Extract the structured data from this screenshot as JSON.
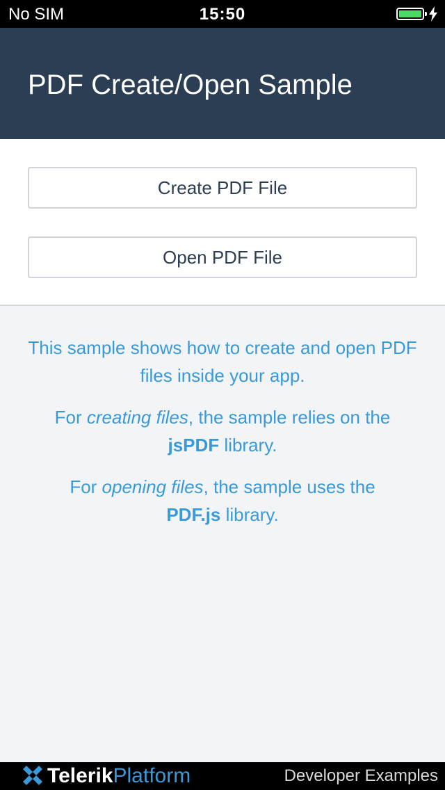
{
  "status_bar": {
    "carrier": "No SIM",
    "time": "15:50",
    "battery_level": 1.0,
    "battery_color": "#4cd964"
  },
  "header": {
    "title": "PDF Create/Open Sample",
    "background": "#2c3e53"
  },
  "actions": {
    "create_label": "Create PDF File",
    "open_label": "Open PDF File"
  },
  "info": {
    "intro": "This sample shows how to create and open PDF files inside your app.",
    "creating": {
      "prefix": "For ",
      "emphasis": "creating files",
      "middle": ", the sample relies on the ",
      "library": "jsPDF",
      "suffix": " library."
    },
    "opening": {
      "prefix": "For ",
      "emphasis": "opening files",
      "middle": ", the sample uses the ",
      "library": "PDF.js",
      "suffix": " library."
    },
    "text_color": "#3a9ad9"
  },
  "footer": {
    "brand_telerik": "Telerik",
    "brand_platform": "Platform",
    "developer_examples": "Developer Examples",
    "logo_icon": "telerik-logo-icon"
  }
}
